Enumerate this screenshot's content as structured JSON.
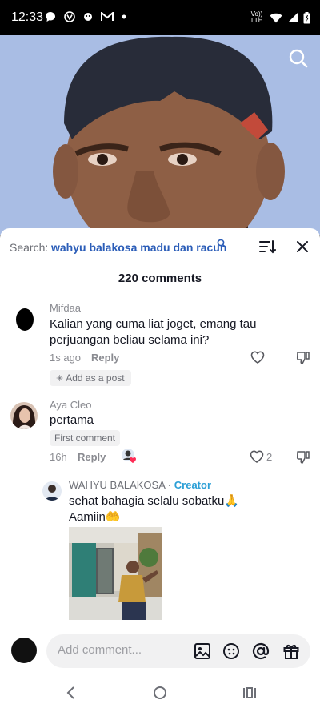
{
  "status_bar": {
    "time": "12:33",
    "network_label": "Vo)) LTE"
  },
  "search": {
    "label": "Search:",
    "query": "wahyu balakosa madu dan racun"
  },
  "comments_header": {
    "count_label": "220 comments"
  },
  "comments": [
    {
      "username": "Mifdaa",
      "text": "Kalian yang cuma liat joget, emang tau perjuangan beliau selama ini?",
      "time": "1s ago",
      "reply_label": "Reply",
      "add_as_post_label": "Add as a post"
    },
    {
      "username": "Aya Cleo",
      "text": "pertama",
      "first_comment_label": "First comment",
      "time": "16h",
      "reply_label": "Reply",
      "like_count": "2"
    }
  ],
  "creator_reply": {
    "username": "WAHYU BALAKOSA",
    "separator": "·",
    "badge": "Creator",
    "text_line1": "sehat bahagia selalu sobatku🙏",
    "text_line2": "Aamiin🤲"
  },
  "input": {
    "placeholder": "Add comment..."
  },
  "colors": {
    "link_blue": "#2b5db8",
    "creator_blue": "#2b9fd6",
    "muted_gray": "#8a8b91"
  }
}
